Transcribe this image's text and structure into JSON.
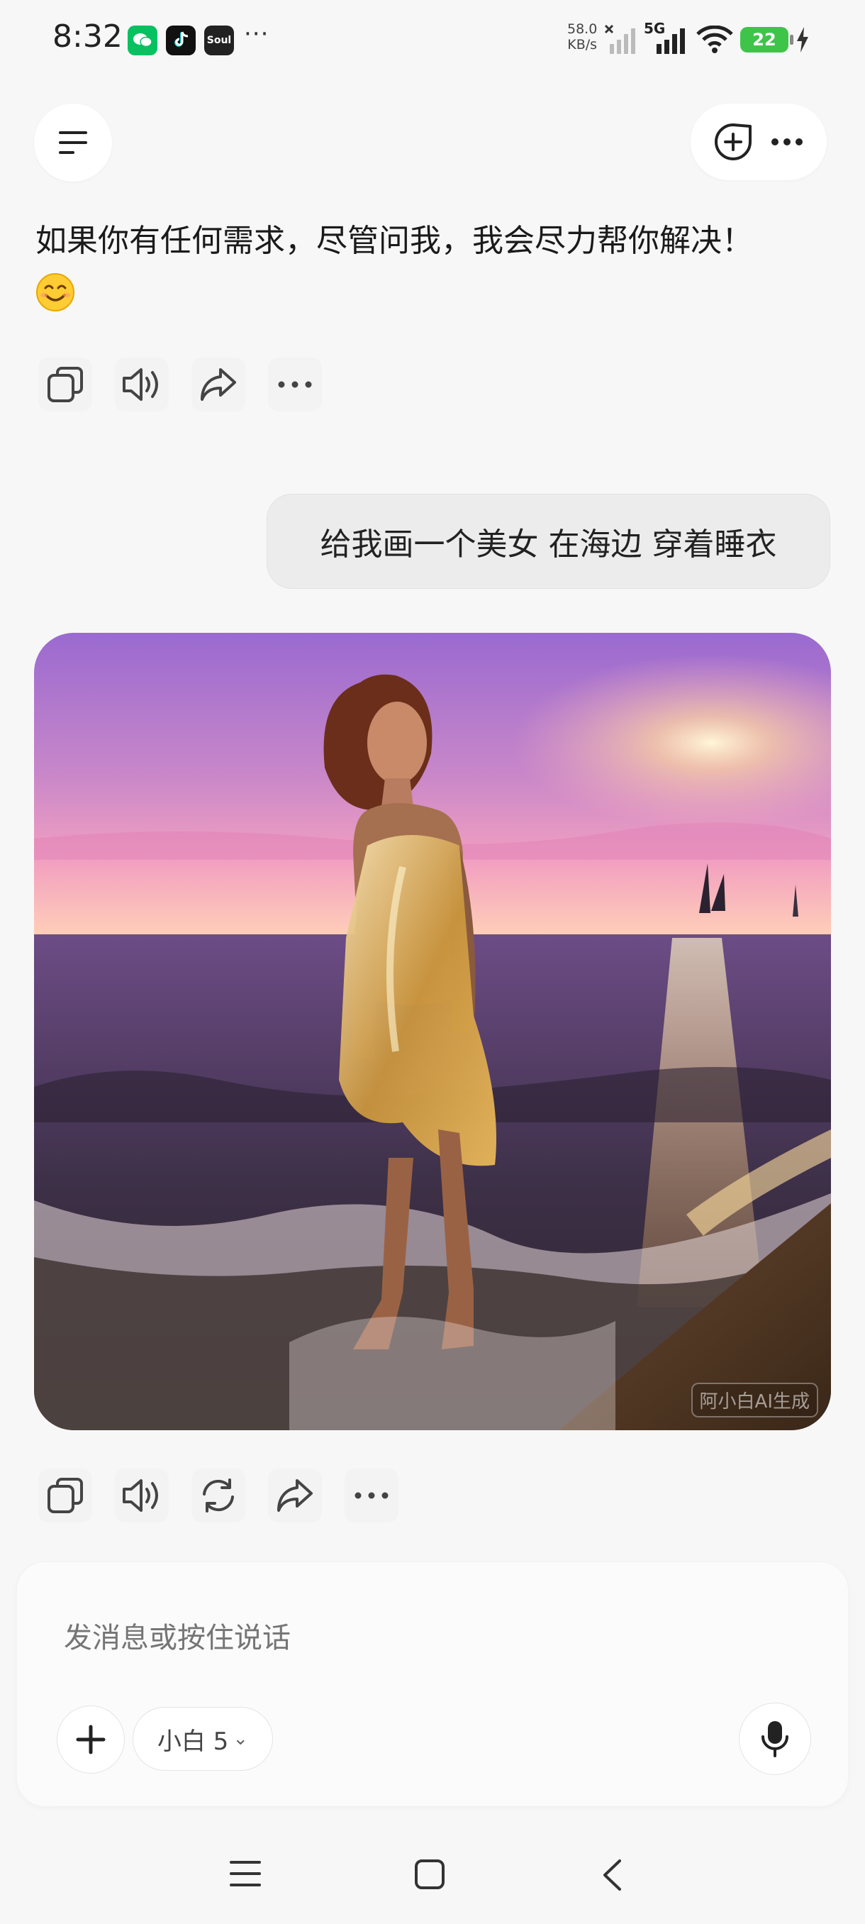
{
  "status_bar": {
    "time": "8:32",
    "apps": [
      {
        "name": "wechat-icon",
        "color": "#07c160",
        "label": ""
      },
      {
        "name": "tiktok-icon",
        "color": "#111111",
        "label": ""
      },
      {
        "name": "soul-icon",
        "color": "#222222",
        "label": "Soul"
      }
    ],
    "more": "···",
    "net_speed_value": "58.0",
    "net_speed_unit": "KB/s",
    "network": "5G",
    "battery": "22",
    "colors": {
      "battery": "#3fc44a"
    }
  },
  "header": {
    "menu_icon": "menu-icon",
    "new_chat_icon": "new-chat-icon",
    "more_icon": "more-icon"
  },
  "conversation": {
    "bot_message": "如果你有任何需求，尽管问我，我会尽力帮你解决！",
    "bot_emoji": "😊",
    "user_message": "给我画一个美女 在海边 穿着睡衣",
    "image_watermark": "阿小白AI生成"
  },
  "message_actions_1": [
    "copy-icon",
    "speaker-icon",
    "share-icon",
    "more-icon"
  ],
  "message_actions_2": [
    "copy-icon",
    "speaker-icon",
    "regenerate-icon",
    "share-icon",
    "more-icon"
  ],
  "composer": {
    "placeholder": "发消息或按住说话",
    "model_label": "小白 5",
    "model_chevron": "⌄"
  },
  "nav": [
    "menu-nav-icon",
    "home-nav-icon",
    "back-nav-icon"
  ]
}
